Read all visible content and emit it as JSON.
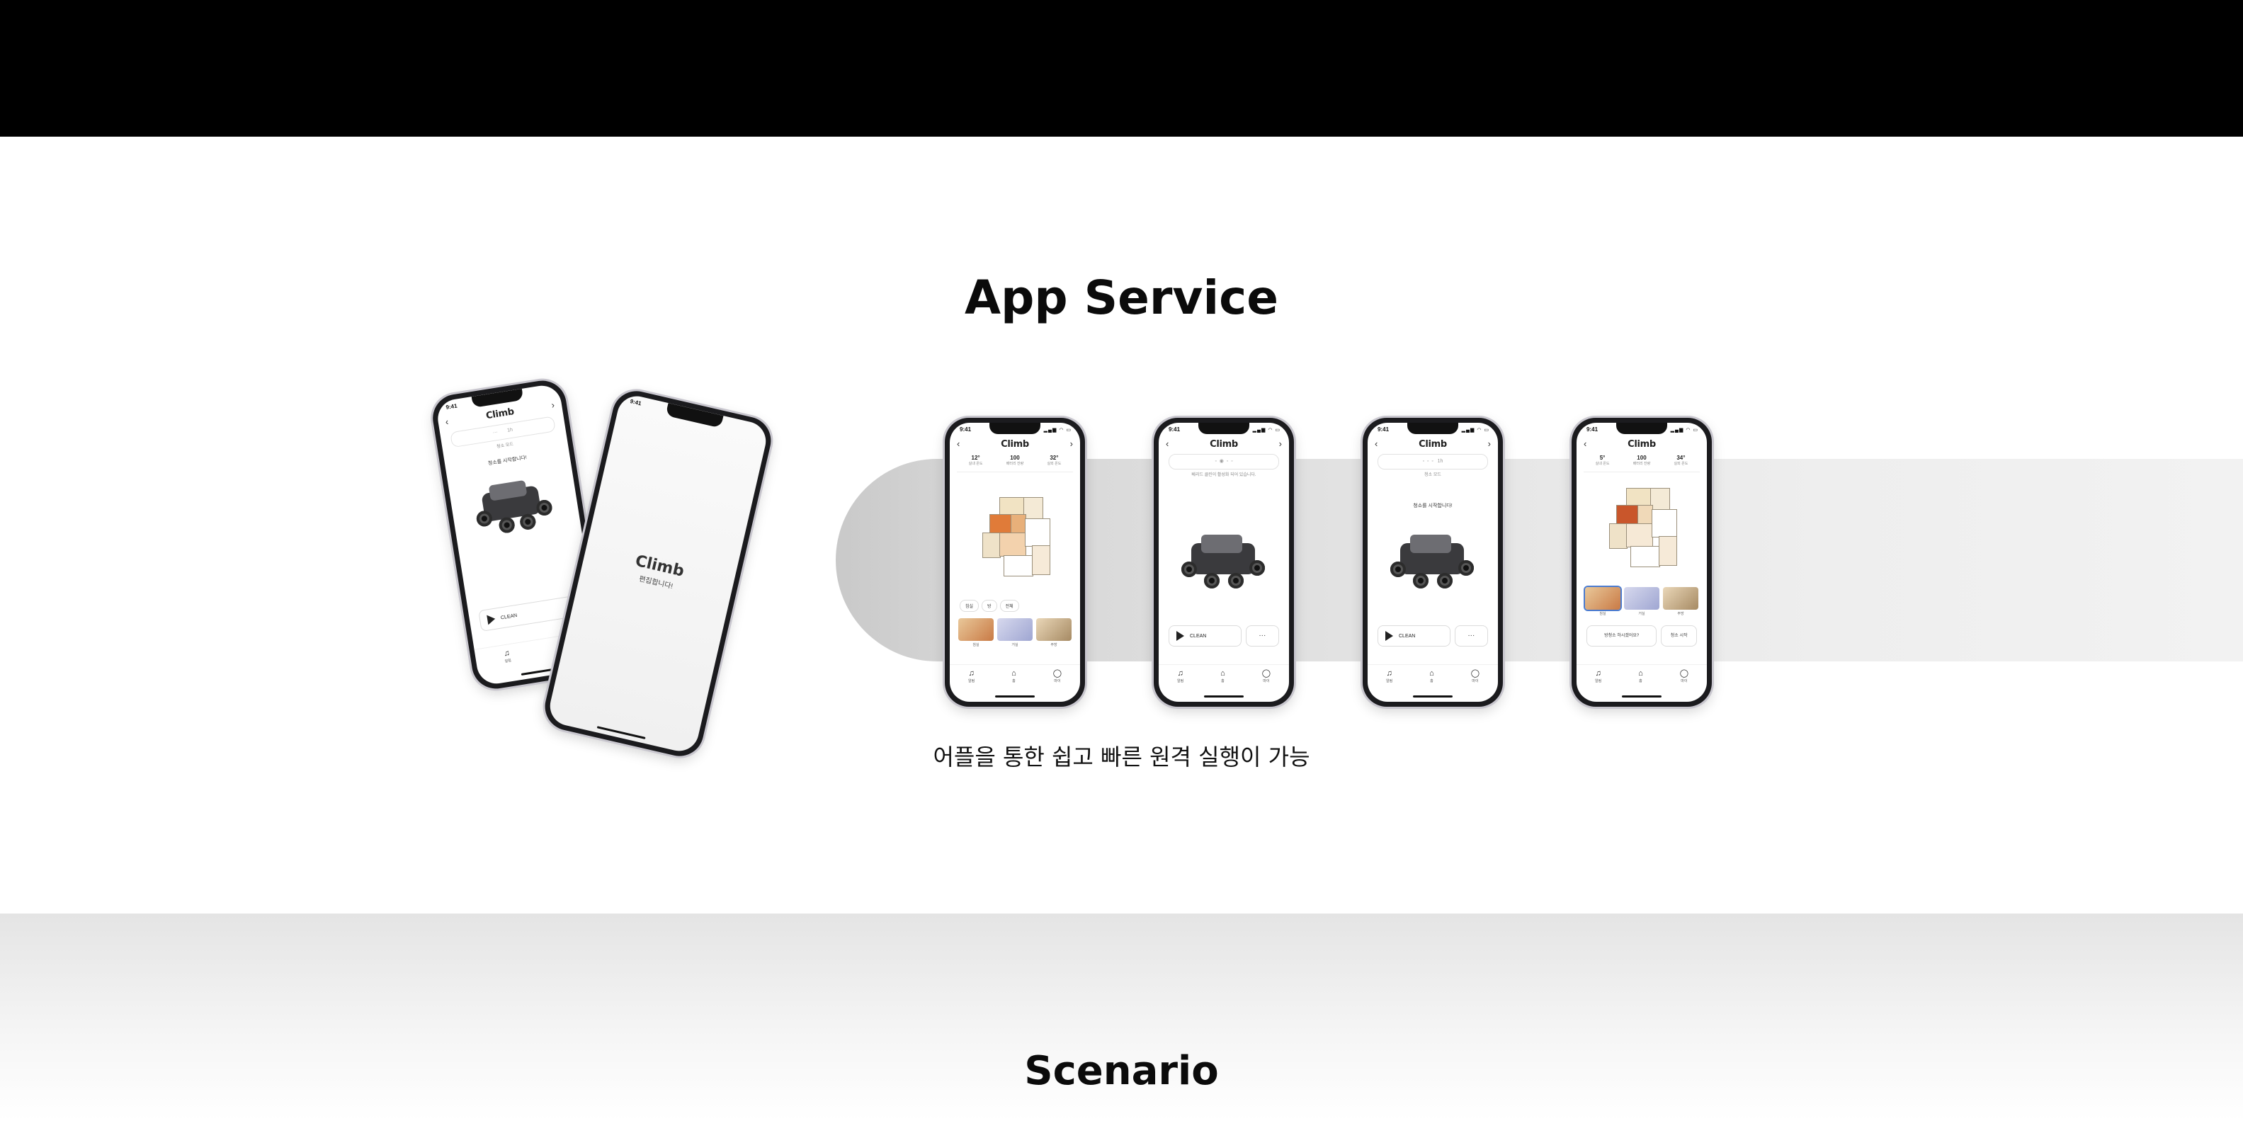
{
  "section": {
    "title": "App Service",
    "subtitle": "어플을 통한 쉽고 빠른 원격 실행이 가능",
    "next_title": "Scenario"
  },
  "brand": {
    "logo": "Climb",
    "splash_tagline": "편집합니다!"
  },
  "colors": {
    "band": "#d9d9d9",
    "topbar": "#000000",
    "accent": "#e07b39"
  },
  "phone": {
    "time": "9:41",
    "status_icons": "▂▄▆ ◠ ▭",
    "back": "‹",
    "forward": "›",
    "stats": [
      {
        "value": "12°",
        "label": "실내 온도"
      },
      {
        "value": "100",
        "label": "배터리 잔량"
      },
      {
        "value": "32°",
        "label": "실외 온도"
      }
    ],
    "stats_alt": [
      {
        "value": "5°",
        "label": "실내 온도"
      },
      {
        "value": "100",
        "label": "배터리 잔량"
      },
      {
        "value": "34°",
        "label": "실외 온도"
      }
    ],
    "chips": [
      "침실",
      "방",
      "전체"
    ],
    "thumb_labels": [
      "침실",
      "거실",
      "주방"
    ],
    "clean_label": "CLEAN",
    "more_label": "···",
    "map_select_label": "방청소 하시겠어요?",
    "start_label": "청소 시작",
    "connect_caption": "베리드 클린이 활성화 되어 있습니다.",
    "mode_caption": "청소 모드",
    "running_caption": "청소를 시작합니다!",
    "tabs": [
      {
        "icon": "♫",
        "label": "알림"
      },
      {
        "icon": "⌂",
        "label": "홈"
      },
      {
        "icon": "◯",
        "label": "마이"
      }
    ]
  }
}
